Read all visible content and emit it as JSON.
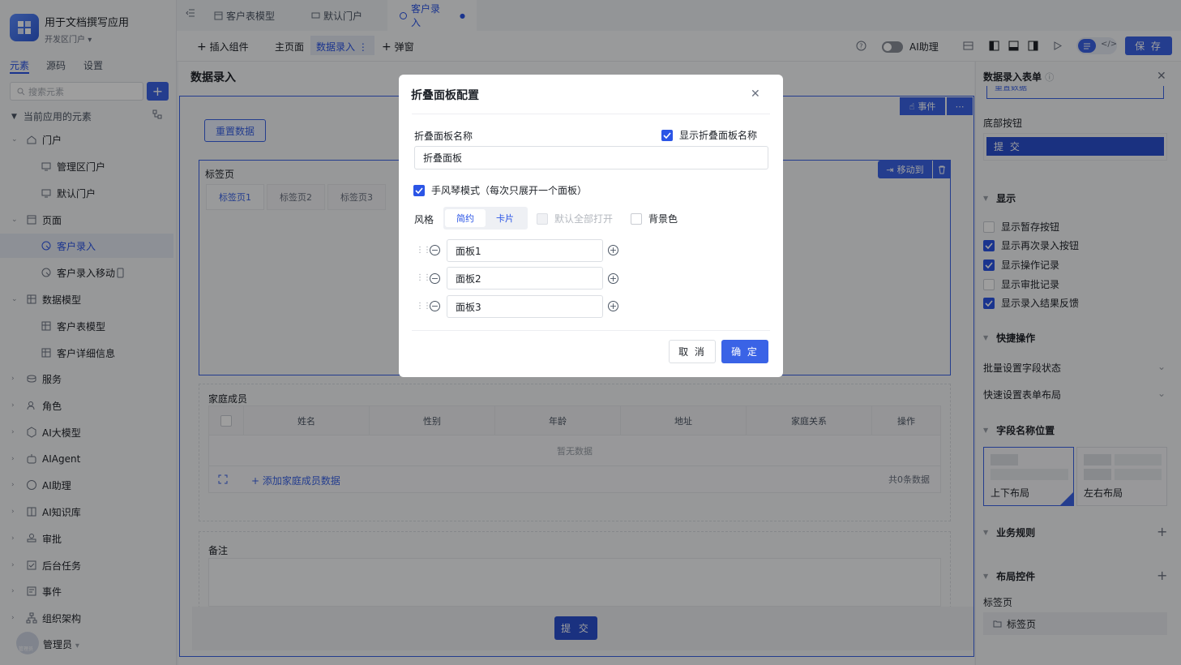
{
  "app": {
    "name": "用于文档撰写应用",
    "portal": "开发区门户"
  },
  "left_tabs": [
    "元素",
    "源码",
    "设置"
  ],
  "search": {
    "placeholder": "搜索元素"
  },
  "tree": {
    "header": "当前应用的元素",
    "items": [
      {
        "label": "门户",
        "icon": "home-icon"
      },
      {
        "label": "管理区门户",
        "icon": "portal-icon"
      },
      {
        "label": "默认门户",
        "icon": "portal-icon"
      },
      {
        "label": "页面",
        "icon": "page-icon"
      },
      {
        "label": "客户录入",
        "icon": "form-icon"
      },
      {
        "label": "客户录入移动",
        "icon": "form-icon"
      },
      {
        "label": "数据模型",
        "icon": "table-icon"
      },
      {
        "label": "客户表模型",
        "icon": "table-icon"
      },
      {
        "label": "客户详细信息",
        "icon": "table-icon"
      },
      {
        "label": "服务",
        "icon": "service-icon"
      },
      {
        "label": "角色",
        "icon": "role-icon"
      },
      {
        "label": "AI大模型",
        "icon": "model-icon"
      },
      {
        "label": "AIAgent",
        "icon": "robot-icon"
      },
      {
        "label": "AI助理",
        "icon": "ai-icon"
      },
      {
        "label": "AI知识库",
        "icon": "book-icon"
      },
      {
        "label": "审批",
        "icon": "stamp-icon"
      },
      {
        "label": "后台任务",
        "icon": "task-icon"
      },
      {
        "label": "事件",
        "icon": "event-icon"
      },
      {
        "label": "组织架构",
        "icon": "org-icon"
      }
    ]
  },
  "user": {
    "name": "管理员",
    "avatar_text": "管理员"
  },
  "doc_tabs": [
    {
      "label": "客户表模型"
    },
    {
      "label": "默认门户"
    },
    {
      "label": "客户录入"
    }
  ],
  "toolbar": {
    "insert": "插入组件",
    "home": "主页面",
    "data_entry": "数据录入",
    "popup": "弹窗",
    "ai_assistant": "AI助理",
    "save": "保 存"
  },
  "canvas": {
    "title": "数据录入",
    "reset_btn": "重置数据",
    "event_btn": "事件",
    "tabs_label": "标签页",
    "move_btn": "移动到",
    "inner_tabs": [
      "标签页1",
      "标签页2",
      "标签页3"
    ],
    "family_label": "家庭成员",
    "table_headers": [
      "姓名",
      "性别",
      "年龄",
      "地址",
      "家庭关系",
      "操作"
    ],
    "empty": "暂无数据",
    "add_row": "添加家庭成员数据",
    "total": "共0条数据",
    "remark_label": "备注",
    "submit": "提 交"
  },
  "right_panel": {
    "title": "数据录入表单",
    "partial_btn": "重置数据",
    "bottom_btn_label": "底部按钮",
    "submit_btn": "提 交",
    "display_section": "显示",
    "display_options": [
      {
        "label": "显示暂存按钮",
        "checked": false
      },
      {
        "label": "显示再次录入按钮",
        "checked": true
      },
      {
        "label": "显示操作记录",
        "checked": true
      },
      {
        "label": "显示审批记录",
        "checked": false
      },
      {
        "label": "显示录入结果反馈",
        "checked": true
      }
    ],
    "quick_section": "快捷操作",
    "batch_field": "批量设置字段状态",
    "quick_layout": "快速设置表单布局",
    "field_pos_section": "字段名称位置",
    "layout_top": "上下布局",
    "layout_lr": "左右布局",
    "rules_section": "业务规则",
    "layout_ctrl_section": "布局控件",
    "tabs_label": "标签页",
    "tabs_item": "标签页"
  },
  "modal": {
    "title": "折叠面板配置",
    "name_label": "折叠面板名称",
    "show_name": "显示折叠面板名称",
    "name_value": "折叠面板",
    "accordion": "手风琴模式（每次只展开一个面板）",
    "style_label": "风格",
    "style_options": [
      "简约",
      "卡片"
    ],
    "expand_all": "默认全部打开",
    "bg_color": "背景色",
    "panels": [
      "面板1",
      "面板2",
      "面板3"
    ],
    "cancel": "取 消",
    "ok": "确 定"
  },
  "colors": {
    "primary": "#3a63e6",
    "dark_primary": "#2b4fcf"
  }
}
